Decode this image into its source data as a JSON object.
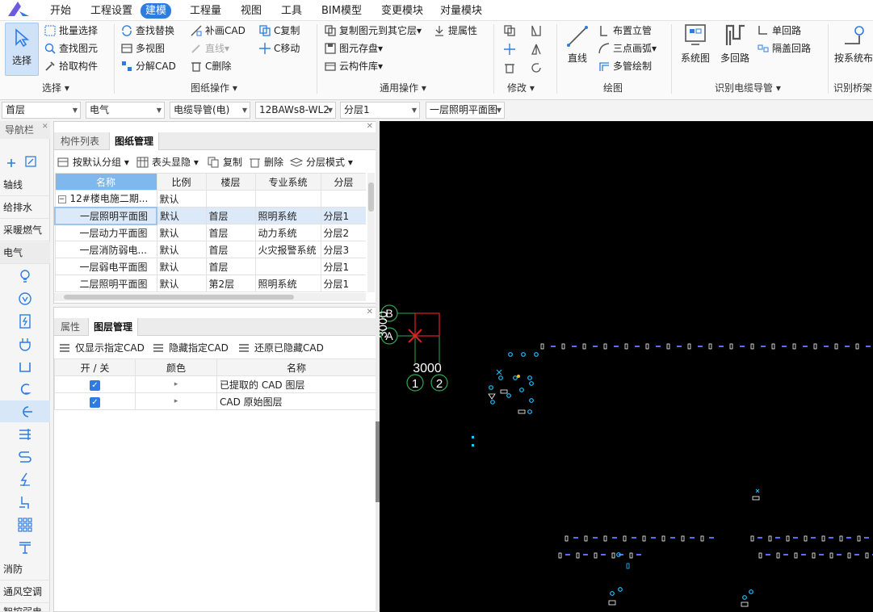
{
  "menu": {
    "items": [
      "开始",
      "工程设置",
      "建模",
      "工程量",
      "视图",
      "工具",
      "BIM模型",
      "变更模块",
      "对量模块"
    ],
    "active_index": 2
  },
  "ribbon": {
    "select_big": "选择",
    "batch_select": "批量选择",
    "find_element": "查找图元",
    "pick_component": "拾取构件",
    "find_replace": "查找替换",
    "multi_view": "多视图",
    "decompose_cad": "分解CAD",
    "supplement_cad": "补画CAD",
    "line_disabled": "直线",
    "c_delete": "C删除",
    "c_copy": "C复制",
    "c_move": "C移动",
    "copy_to_floor": "复制图元到其它层",
    "extract_attr": "提属性",
    "save_element": "图元存盘",
    "cloud_library": "云构件库",
    "draw_line": "直线",
    "riser": "布置立管",
    "three_point_arc": "三点画弧",
    "multi_pipe": "多管绘制",
    "system_diagram": "系统图",
    "multi_loop": "多回路",
    "single_loop": "单回路",
    "hidden_loop": "隔盖回路",
    "by_system": "按系统布",
    "groups": {
      "select": "选择",
      "drawing_ops": "图纸操作",
      "general_ops": "通用操作",
      "modify": "修改",
      "draw": "绘图",
      "identify_cable": "识别电缆导管",
      "identify_tray": "识别桥架"
    }
  },
  "dropdowns": {
    "floor": "首层",
    "discipline": "电气",
    "component_type": "电缆导管(电)",
    "component": "12BAWs8-WL2",
    "layer": "分层1",
    "drawing": "一层照明平面图"
  },
  "nav": {
    "title": "导航栏",
    "categories_top": [
      "轴线",
      "给排水",
      "采暖燃气",
      "电气"
    ],
    "categories_bottom": [
      "消防",
      "通风空调",
      "智控弱电"
    ]
  },
  "drawing_panel": {
    "tabs": [
      "构件列表",
      "图纸管理"
    ],
    "active_tab": 1,
    "toolbar": {
      "group_default": "按默认分组",
      "header_toggle": "表头显隐",
      "copy": "复制",
      "delete": "删除",
      "layer_mode": "分层模式"
    },
    "columns": [
      "名称",
      "比例",
      "楼层",
      "专业系统",
      "分层"
    ],
    "rows": [
      {
        "name": "12#楼电施二期...",
        "scale": "默认",
        "floor": "",
        "system": "",
        "layer": "",
        "group": true
      },
      {
        "name": "一层照明平面图",
        "scale": "默认",
        "floor": "首层",
        "system": "照明系统",
        "layer": "分层1",
        "selected": true
      },
      {
        "name": "一层动力平面图",
        "scale": "默认",
        "floor": "首层",
        "system": "动力系统",
        "layer": "分层2"
      },
      {
        "name": "一层消防弱电...",
        "scale": "默认",
        "floor": "首层",
        "system": "火灾报警系统",
        "layer": "分层3"
      },
      {
        "name": "一层弱电平面图",
        "scale": "默认",
        "floor": "首层",
        "system": "",
        "layer": "分层1"
      },
      {
        "name": "二层照明平面图",
        "scale": "默认",
        "floor": "第2层",
        "system": "照明系统",
        "layer": "分层1"
      }
    ]
  },
  "layer_panel": {
    "tabs": [
      "属性",
      "图层管理"
    ],
    "active_tab": 1,
    "toolbar": {
      "show_only": "仅显示指定CAD",
      "hide": "隐藏指定CAD",
      "restore": "还原已隐藏CAD"
    },
    "columns": [
      "开 / 关",
      "颜色",
      "名称"
    ],
    "rows": [
      {
        "on": true,
        "name": "已提取的 CAD 图层"
      },
      {
        "on": true,
        "name": "CAD 原始图层"
      }
    ]
  },
  "canvas": {
    "axis_label_b": "B",
    "axis_label_a": "A",
    "dim_vertical": "3000",
    "dim_horizontal": "3000",
    "axis_label_1": "1",
    "axis_label_2": "2"
  },
  "colors": {
    "accent": "#2e7ce0",
    "canvas_bg": "#000000",
    "axis_green": "#2fa84f",
    "axis_red": "#e02020",
    "cad_cyan": "#19c6ff",
    "cad_white": "#ffffff",
    "cad_blue": "#5a6cff"
  }
}
